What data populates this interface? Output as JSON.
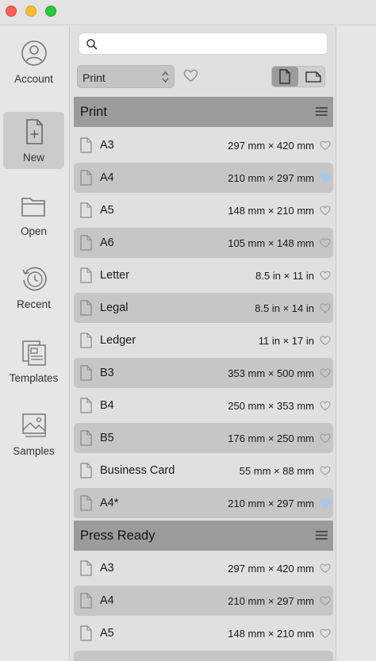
{
  "sidebar": {
    "items": [
      {
        "label": "Account",
        "icon": "account-icon"
      },
      {
        "label": "New",
        "icon": "new-document-icon",
        "active": true
      },
      {
        "label": "Open",
        "icon": "folder-icon"
      },
      {
        "label": "Recent",
        "icon": "recent-clock-icon"
      },
      {
        "label": "Templates",
        "icon": "templates-icon"
      },
      {
        "label": "Samples",
        "icon": "samples-image-icon"
      }
    ]
  },
  "search": {
    "placeholder": "",
    "value": ""
  },
  "category_select": {
    "value": "Print"
  },
  "orientation": {
    "selected": "portrait"
  },
  "colors": {
    "favorite_on": "#a9c8ea",
    "favorite_off": "#9a9a9a",
    "active_bg": "#cbcbcb"
  },
  "sections": [
    {
      "title": "Print",
      "rows": [
        {
          "name": "A3",
          "size": "297 mm × 420 mm",
          "favorite": false
        },
        {
          "name": "A4",
          "size": "210 mm × 297 mm",
          "favorite": true
        },
        {
          "name": "A5",
          "size": "148 mm × 210 mm",
          "favorite": false
        },
        {
          "name": "A6",
          "size": "105 mm × 148 mm",
          "favorite": false
        },
        {
          "name": "Letter",
          "size": "8.5 in × 11 in",
          "favorite": false
        },
        {
          "name": "Legal",
          "size": "8.5 in × 14 in",
          "favorite": false
        },
        {
          "name": "Ledger",
          "size": "11 in × 17 in",
          "favorite": false
        },
        {
          "name": "B3",
          "size": "353 mm × 500 mm",
          "favorite": false
        },
        {
          "name": "B4",
          "size": "250 mm × 353 mm",
          "favorite": false
        },
        {
          "name": "B5",
          "size": "176 mm × 250 mm",
          "favorite": false
        },
        {
          "name": "Business Card",
          "size": "55 mm × 88 mm",
          "favorite": false
        },
        {
          "name": "A4*",
          "size": "210 mm × 297 mm",
          "favorite": true
        }
      ]
    },
    {
      "title": "Press Ready",
      "rows": [
        {
          "name": "A3",
          "size": "297 mm × 420 mm",
          "favorite": false
        },
        {
          "name": "A4",
          "size": "210 mm × 297 mm",
          "favorite": false
        },
        {
          "name": "A5",
          "size": "148 mm × 210 mm",
          "favorite": false
        },
        {
          "name": "",
          "size": "",
          "favorite": false
        }
      ]
    }
  ]
}
